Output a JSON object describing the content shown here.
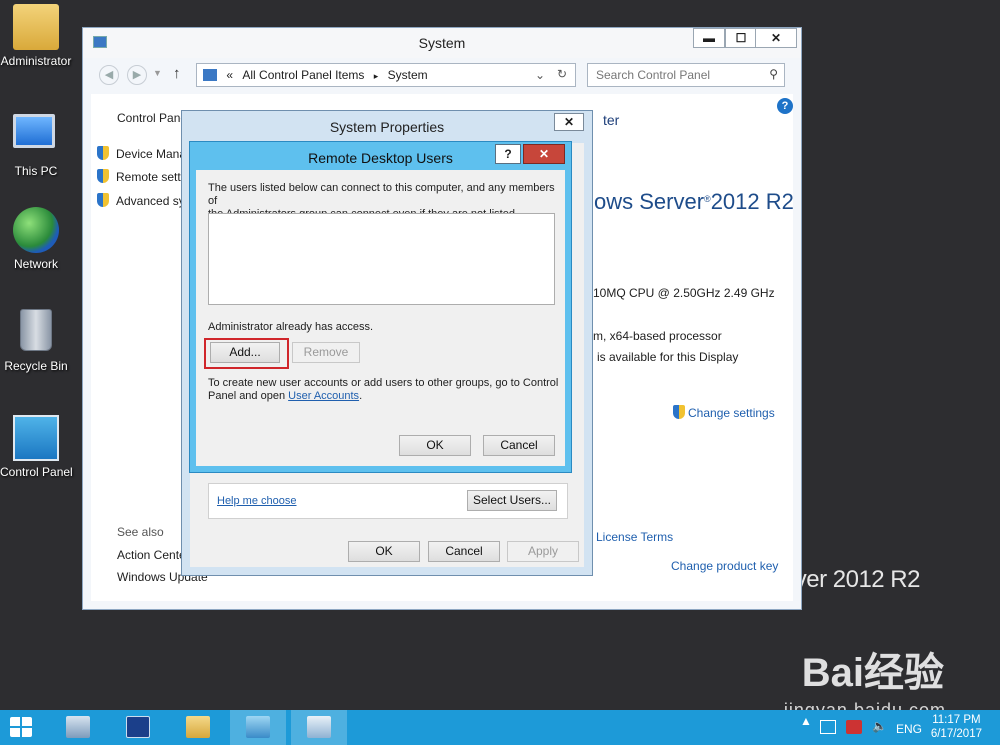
{
  "desktop": {
    "icons": [
      {
        "label": "Administrator",
        "icon": "user-folder-icon"
      },
      {
        "label": "This PC",
        "icon": "computer-icon"
      },
      {
        "label": "Network",
        "icon": "network-icon"
      },
      {
        "label": "Recycle Bin",
        "icon": "recycle-bin-icon"
      },
      {
        "label": "Control Panel",
        "icon": "control-panel-icon"
      }
    ],
    "background_brand": "rver 2012 R2"
  },
  "system_window": {
    "title": "System",
    "buttons": {
      "minimize": "▬",
      "maximize": "☐",
      "close": "✕"
    },
    "breadcrumb": {
      "prefix": "«",
      "root": "All Control Panel Items",
      "separator": "▸",
      "current": "System"
    },
    "search_placeholder": "Search Control Panel",
    "sidebar": {
      "home": "Control Pane",
      "links": [
        "Device Mana",
        "Remote setti",
        "Advanced sy"
      ],
      "see_also_label": "See also",
      "see_also": [
        "Action Cente",
        "Windows Update"
      ]
    },
    "content": {
      "header_fragment": "ter",
      "edition": "ows Server",
      "edition_suffix": "2012 R2",
      "cpu": "10MQ CPU @ 2.50GHz   2.49 GHz",
      "system_type": "m, x64-based processor",
      "pen_touch": "is available for this Display",
      "change_settings": "Change settings",
      "license_terms": "License Terms",
      "change_product_key": "Change product key"
    }
  },
  "system_properties": {
    "title": "System Properties",
    "close": "✕",
    "help_me_choose": "Help me choose",
    "select_users": "Select Users...",
    "ok": "OK",
    "cancel": "Cancel",
    "apply": "Apply"
  },
  "remote_desktop_users": {
    "title": "Remote Desktop Users",
    "help": "?",
    "close": "✕",
    "intro_line1": "The users listed below can connect to this computer, and any members of",
    "intro_line2": "the Administrators group can connect even if they are not listed.",
    "users": [],
    "access_note": "Administrator already has access.",
    "add": "Add...",
    "remove": "Remove",
    "footer_line1": "To create new user accounts or add users to other groups, go to Control",
    "footer_line2_prefix": "Panel and open ",
    "footer_link": "User Accounts",
    "footer_line2_suffix": ".",
    "ok": "OK",
    "cancel": "Cancel"
  },
  "taskbar": {
    "items": [
      "start-icon",
      "server-manager-icon",
      "powershell-icon",
      "file-explorer-icon",
      "control-panel-icon",
      "system-properties-icon"
    ],
    "language": "ENG",
    "time": "11:17 PM",
    "date": "6/17/2017"
  },
  "watermark": {
    "brand": "Bai经验",
    "url": "jingyan.baidu.com"
  }
}
